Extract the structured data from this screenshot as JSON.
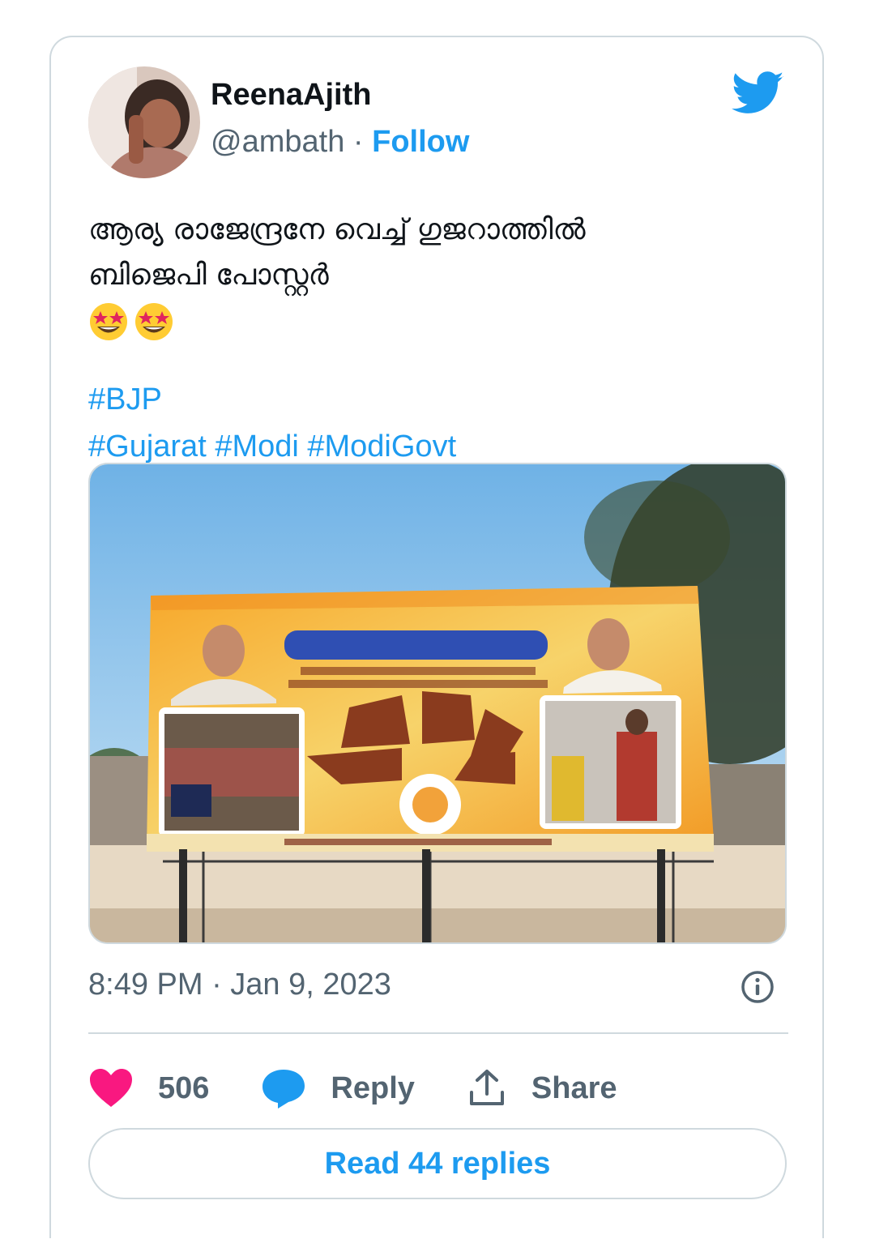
{
  "tweet": {
    "author_name": "ReenaAjith",
    "author_handle": "@ambath",
    "separator": " · ",
    "follow_label": "Follow",
    "text_line_1": "ആര്യ രാജേന്ദ്രനേ വെച്ച് ഗുജറാത്തിൽ",
    "text_line_2": "ബിജെപി പോസ്റ്റർ",
    "emojis": [
      "star-struck-emoji",
      "star-struck-emoji"
    ],
    "hashtag_1": "#BJP",
    "hashtag_2": "#Gujarat",
    "hashtag_3": "#Modi",
    "hashtag_4": "#ModiGovt",
    "timestamp": "8:49 PM · Jan 9, 2023",
    "likes_count": "506",
    "reply_label": "Reply",
    "share_label": "Share",
    "read_replies_label": "Read 44 replies"
  },
  "colors": {
    "accent": "#1d9bf0",
    "text_primary": "#0f1419",
    "text_secondary": "#536471",
    "border": "#cfd9de",
    "like": "#f91880"
  },
  "icons": [
    "twitter-bird-icon",
    "info-icon",
    "heart-icon",
    "reply-bubble-icon",
    "share-icon"
  ]
}
